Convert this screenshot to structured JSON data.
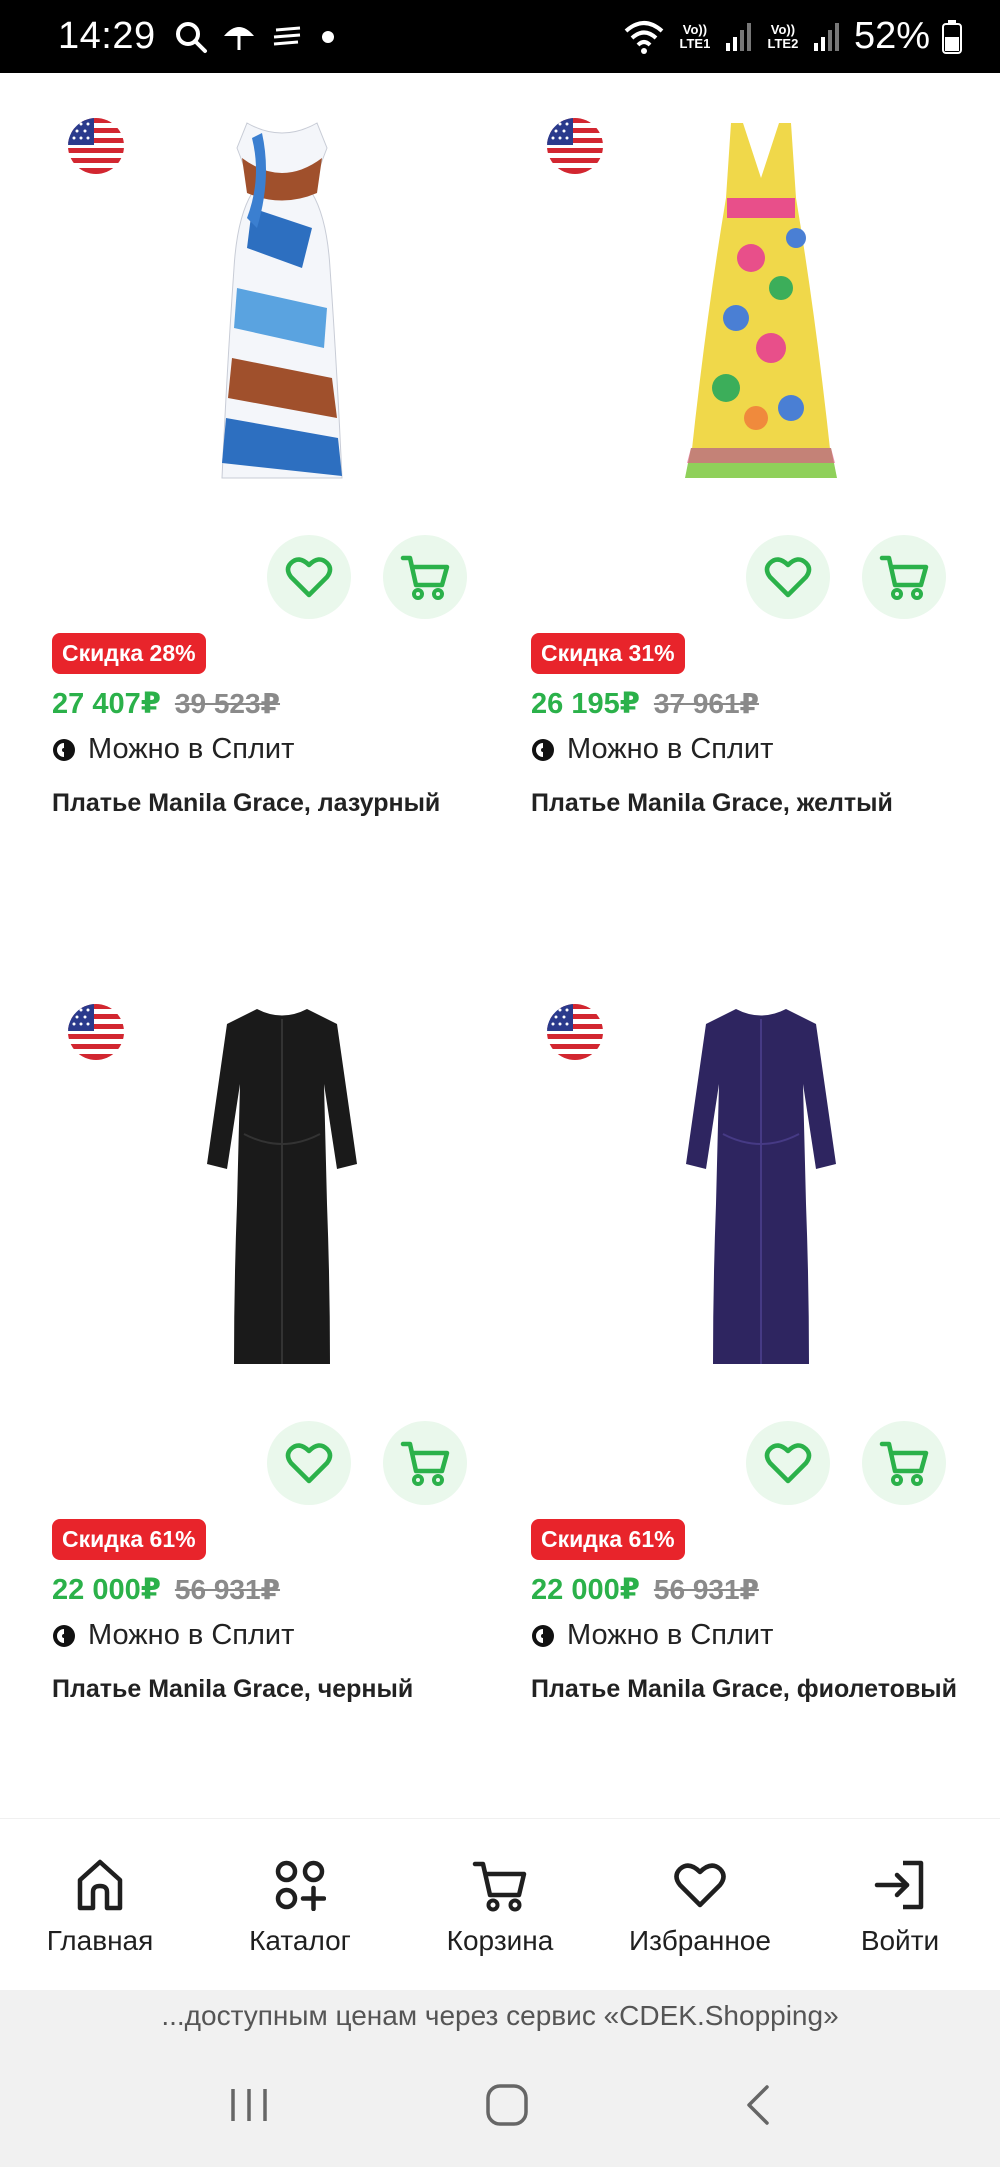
{
  "status_bar": {
    "time": "14:29",
    "lte1": "Vo)) LTE1",
    "lte2": "Vo)) LTE2",
    "battery": "52%"
  },
  "products": [
    {
      "discount": "Скидка 28%",
      "price": "27 407₽",
      "old_price": "39 523₽",
      "split": "Можно в Сплит",
      "title": "Платье Manila Grace, лазурный"
    },
    {
      "discount": "Скидка 31%",
      "price": "26 195₽",
      "old_price": "37 961₽",
      "split": "Можно в Сплит",
      "title": "Платье Manila Grace, желтый"
    },
    {
      "discount": "Скидка 61%",
      "price": "22 000₽",
      "old_price": "56 931₽",
      "split": "Можно в Сплит",
      "title": "Платье Manila Grace, черный"
    },
    {
      "discount": "Скидка 61%",
      "price": "22 000₽",
      "old_price": "56 931₽",
      "split": "Можно в Сплит",
      "title": "Платье Manila Grace, фиолетовый"
    }
  ],
  "nav": {
    "items": [
      {
        "label": "Главная",
        "icon": "home-icon"
      },
      {
        "label": "Каталог",
        "icon": "catalog-icon"
      },
      {
        "label": "Корзина",
        "icon": "cart-icon"
      },
      {
        "label": "Избранное",
        "icon": "heart-icon"
      },
      {
        "label": "Войти",
        "icon": "login-icon"
      }
    ]
  },
  "banner": {
    "text": "...доступным ценам через сервис «CDEK.Shopping»"
  },
  "colors": {
    "accent_green": "#2bb14a",
    "discount_red": "#e8242b",
    "action_bg": "#eaf8ec"
  }
}
